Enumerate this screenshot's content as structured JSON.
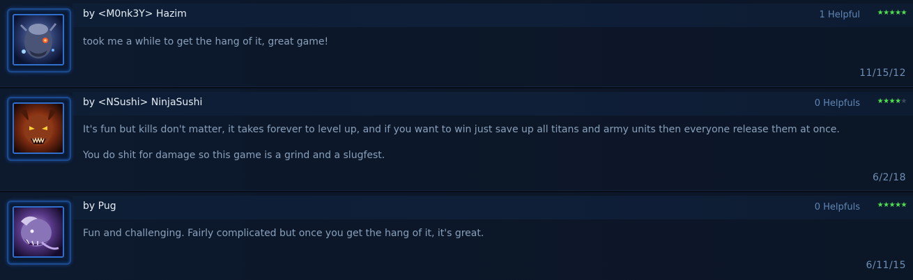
{
  "reviews": [
    {
      "author": "by <M0nk3Y> Hazim",
      "helpful": "1 Helpful",
      "rating": 5,
      "paragraphs": [
        "took me a while to get the hang of it, great game!"
      ],
      "date": "11/15/12",
      "avatar_icon": "demon-portrait-icon"
    },
    {
      "author": "by <NSushi> NinjaSushi",
      "helpful": "0 Helpfuls",
      "rating": 4,
      "paragraphs": [
        "It's fun but kills don't matter, it takes forever to level up, and if you want to win just save up all titans and army units then everyone release them at once.",
        "You do shit for damage so this game is a grind and a slugfest."
      ],
      "date": "6/2/18",
      "avatar_icon": "hellion-portrait-icon"
    },
    {
      "author": "by Pug",
      "helpful": "0 Helpfuls",
      "rating": 5,
      "paragraphs": [
        "Fun and challenging. Fairly complicated but once you get the hang of it, it's great."
      ],
      "date": "6/11/15",
      "avatar_icon": "purple-beast-portrait-icon"
    }
  ],
  "colors": {
    "star_on": "#4fe24d",
    "star_off": "#3b4a5c",
    "avatar_border": "#2e6fd0",
    "helpful_text": "#5f86b4"
  }
}
